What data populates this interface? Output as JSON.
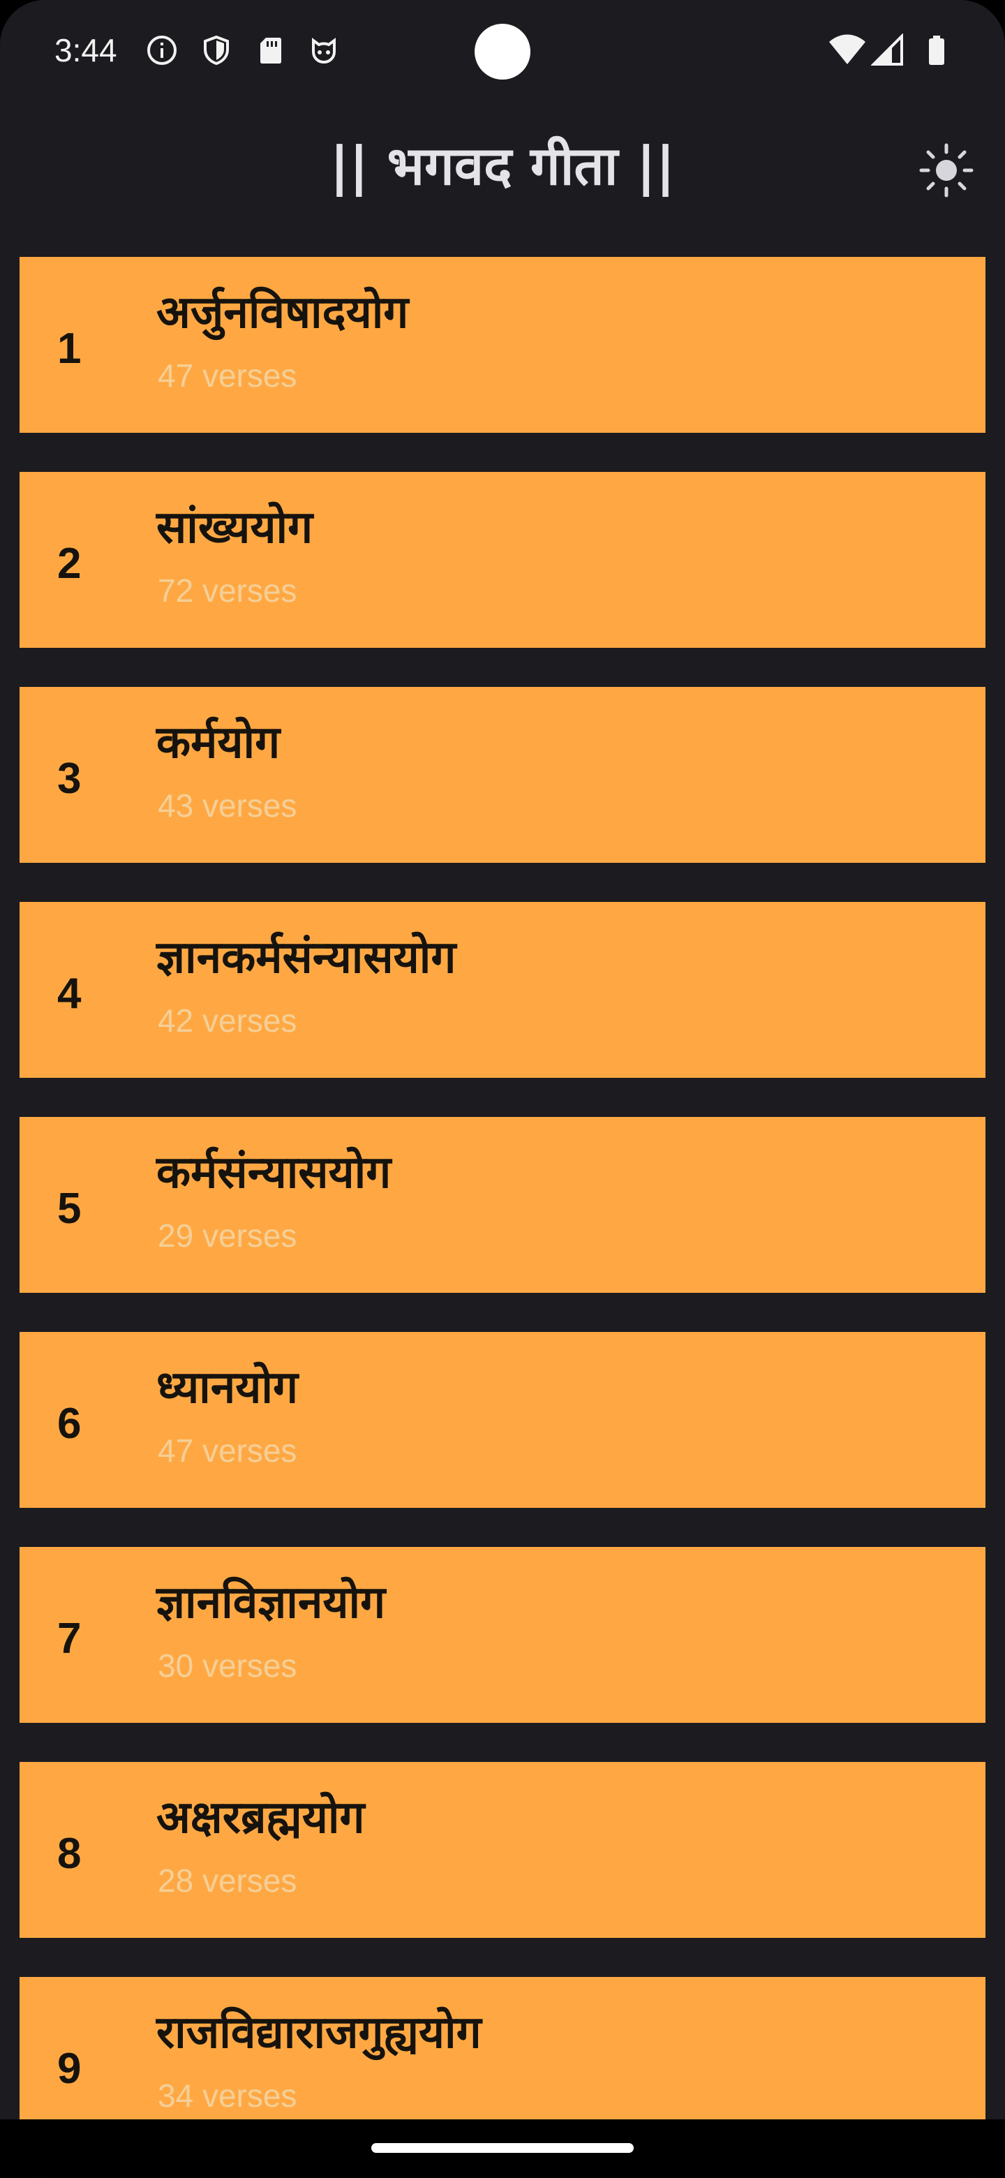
{
  "status_bar": {
    "time": "3:44",
    "icons": [
      "info-icon",
      "shield-icon",
      "sd-card-icon",
      "cat-face-icon",
      "wifi-icon",
      "cellular-signal-icon",
      "battery-icon"
    ]
  },
  "header": {
    "title": "|| भगवद गीता ||",
    "theme_icon": "sun-icon"
  },
  "colors": {
    "background": "#1c1b20",
    "card": "#ffa843",
    "card_text": "#16130e",
    "verses_text": "#f5cf97",
    "header_text": "#e4e3e8"
  },
  "chapters": [
    {
      "number": "1",
      "name": "अर्जुनविषादयोग",
      "verses": "47 verses"
    },
    {
      "number": "2",
      "name": "सांख्ययोग",
      "verses": "72 verses"
    },
    {
      "number": "3",
      "name": "कर्मयोग",
      "verses": "43 verses"
    },
    {
      "number": "4",
      "name": "ज्ञानकर्मसंन्यासयोग",
      "verses": "42 verses"
    },
    {
      "number": "5",
      "name": "कर्मसंन्यासयोग",
      "verses": "29 verses"
    },
    {
      "number": "6",
      "name": "ध्यानयोग",
      "verses": "47 verses"
    },
    {
      "number": "7",
      "name": "ज्ञानविज्ञानयोग",
      "verses": "30 verses"
    },
    {
      "number": "8",
      "name": "अक्षरब्रह्मयोग",
      "verses": "28 verses"
    },
    {
      "number": "9",
      "name": "राजविद्याराजगुह्ययोग",
      "verses": "34 verses"
    }
  ]
}
